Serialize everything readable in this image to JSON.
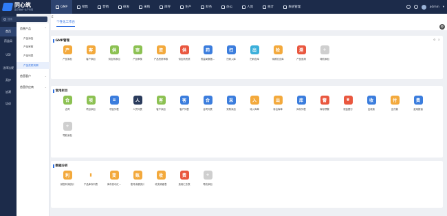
{
  "logo": {
    "title": "同心筑",
    "subtitle": "医疗器械一生产管理"
  },
  "nav": [
    {
      "label": "GMP",
      "active": true
    },
    {
      "label": "销售"
    },
    {
      "label": "营销"
    },
    {
      "label": "研发"
    },
    {
      "label": "采购"
    },
    {
      "label": "库存"
    },
    {
      "label": "生产"
    },
    {
      "label": "财务"
    },
    {
      "label": "办公"
    },
    {
      "label": "人资"
    },
    {
      "label": "统计"
    },
    {
      "label": "系统管理"
    }
  ],
  "user": {
    "name": "admin"
  },
  "search": {
    "placeholder": "搜索"
  },
  "rail": [
    {
      "label": "首页",
      "active": true
    },
    {
      "label": "药监局"
    },
    {
      "label": "UDI"
    },
    {
      "label": "法律法规"
    },
    {
      "label": "养护"
    },
    {
      "label": "追溯"
    },
    {
      "label": "培训"
    }
  ],
  "submenu": {
    "group1": "首营产品",
    "items": [
      "产品添加",
      "产品审核",
      "产品列表",
      "产品资质到期"
    ],
    "group2": "首营客户",
    "group3": "首营供应商"
  },
  "tabs": {
    "toggle": "E",
    "active": "个性化工作台",
    "gear": "⚙"
  },
  "sections": [
    {
      "title": "GMP管理",
      "items": [
        {
          "label": "产品添加",
          "color": "#f3a93c",
          "glyph": "产"
        },
        {
          "label": "客户添加",
          "color": "#f3a93c",
          "glyph": "客"
        },
        {
          "label": "供应商添加",
          "color": "#8cc152",
          "glyph": "供"
        },
        {
          "label": "产品审核",
          "color": "#8cc152",
          "glyph": "审"
        },
        {
          "label": "产品资质审核",
          "color": "#f3a93c",
          "glyph": "资"
        },
        {
          "label": "供应商资质",
          "color": "#e9573f",
          "glyph": "供"
        },
        {
          "label": "药监局数据...",
          "color": "#3b7ddd",
          "glyph": "药"
        },
        {
          "label": "扫码入库",
          "color": "#3b7ddd",
          "glyph": "扫"
        },
        {
          "label": "扫码出库",
          "color": "#3bafda",
          "glyph": "出"
        },
        {
          "label": "待质检出库",
          "color": "#f3a93c",
          "glyph": "检"
        },
        {
          "label": "产品追溯",
          "color": "#e9573f",
          "glyph": "溯"
        },
        {
          "label": "导航添加",
          "color": "#cfcfcf",
          "glyph": "+"
        }
      ]
    },
    {
      "title": "常用栏目",
      "items": [
        {
          "label": "合同",
          "color": "#8cc152",
          "glyph": "合"
        },
        {
          "label": "项目添加",
          "color": "#8cc152",
          "glyph": "项"
        },
        {
          "label": "项目列表",
          "color": "#3b7ddd",
          "glyph": "≡"
        },
        {
          "label": "人员列表",
          "color": "#2a3b5c",
          "glyph": "人"
        },
        {
          "label": "客户添加",
          "color": "#8cc152",
          "glyph": "客"
        },
        {
          "label": "客户列表",
          "color": "#3b7ddd",
          "glyph": "客"
        },
        {
          "label": "合同列表",
          "color": "#3b7ddd",
          "glyph": "合"
        },
        {
          "label": "采购添加",
          "color": "#3b7ddd",
          "glyph": "采"
        },
        {
          "label": "待入库单",
          "color": "#f3a93c",
          "glyph": "入"
        },
        {
          "label": "待出库单",
          "color": "#f3a93c",
          "glyph": "出"
        },
        {
          "label": "库存列表",
          "color": "#3b7ddd",
          "glyph": "库"
        },
        {
          "label": "库存预警",
          "color": "#e9573f",
          "glyph": "警"
        },
        {
          "label": "现金银行",
          "color": "#e9573f",
          "glyph": "¥"
        },
        {
          "label": "应收款",
          "color": "#3b7ddd",
          "glyph": "收"
        },
        {
          "label": "应付款",
          "color": "#f3a93c",
          "glyph": "付"
        },
        {
          "label": "费用报销",
          "color": "#3b7ddd",
          "glyph": "费"
        },
        {
          "label": "导航添加",
          "color": "#cfcfcf",
          "glyph": "+"
        }
      ]
    },
    {
      "title": "数据分析",
      "items": [
        {
          "label": "销售利润统计",
          "color": "#f3a93c",
          "glyph": "利"
        },
        {
          "label": "产品库存列表",
          "color": "#ffffff",
          "glyph": "▮"
        },
        {
          "label": "库存变动汇...",
          "color": "#f3a93c",
          "glyph": "变"
        },
        {
          "label": "账号余额统计",
          "color": "#f3a93c",
          "glyph": "账"
        },
        {
          "label": "收支明细表",
          "color": "#f3a93c",
          "glyph": "收"
        },
        {
          "label": "费用汇总表",
          "color": "#e9573f",
          "glyph": "费"
        },
        {
          "label": "导航添加",
          "color": "#cfcfcf",
          "glyph": "+"
        }
      ]
    }
  ]
}
